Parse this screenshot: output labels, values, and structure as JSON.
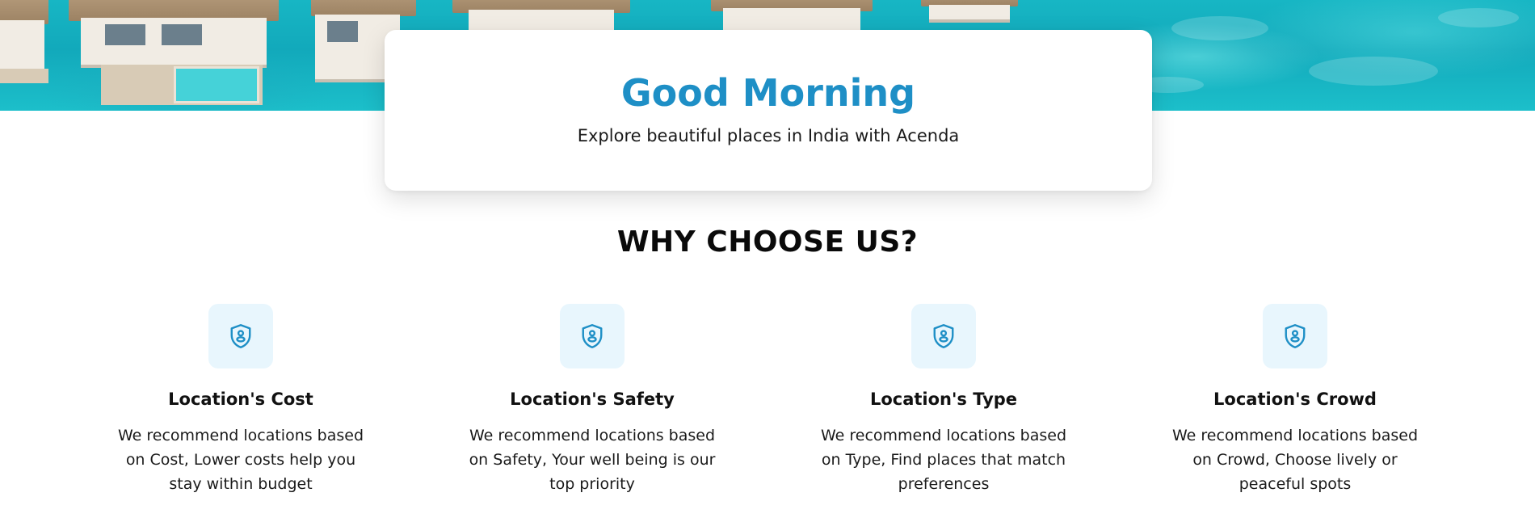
{
  "greeting": {
    "title": "Good Morning",
    "subtitle": "Explore beautiful places in India with Acenda"
  },
  "why_choose_us": {
    "title": "WHY CHOOSE US?",
    "features": [
      {
        "icon": "shield-user-icon",
        "title": "Location's Cost",
        "description": "We recommend locations based on Cost, Lower costs help you stay within budget"
      },
      {
        "icon": "shield-user-icon",
        "title": "Location's Safety",
        "description": "We recommend locations based on Safety, Your well being is our top priority"
      },
      {
        "icon": "shield-user-icon",
        "title": "Location's Type",
        "description": "We recommend locations based on Type, Find places that match preferences"
      },
      {
        "icon": "shield-user-icon",
        "title": "Location's Crowd",
        "description": "We recommend locations based on Crowd, Choose lively or peaceful spots"
      }
    ]
  },
  "colors": {
    "accent": "#1e8fc6",
    "icon_background": "#e8f6fd",
    "text": "#111111",
    "water": "#17b6c4"
  }
}
